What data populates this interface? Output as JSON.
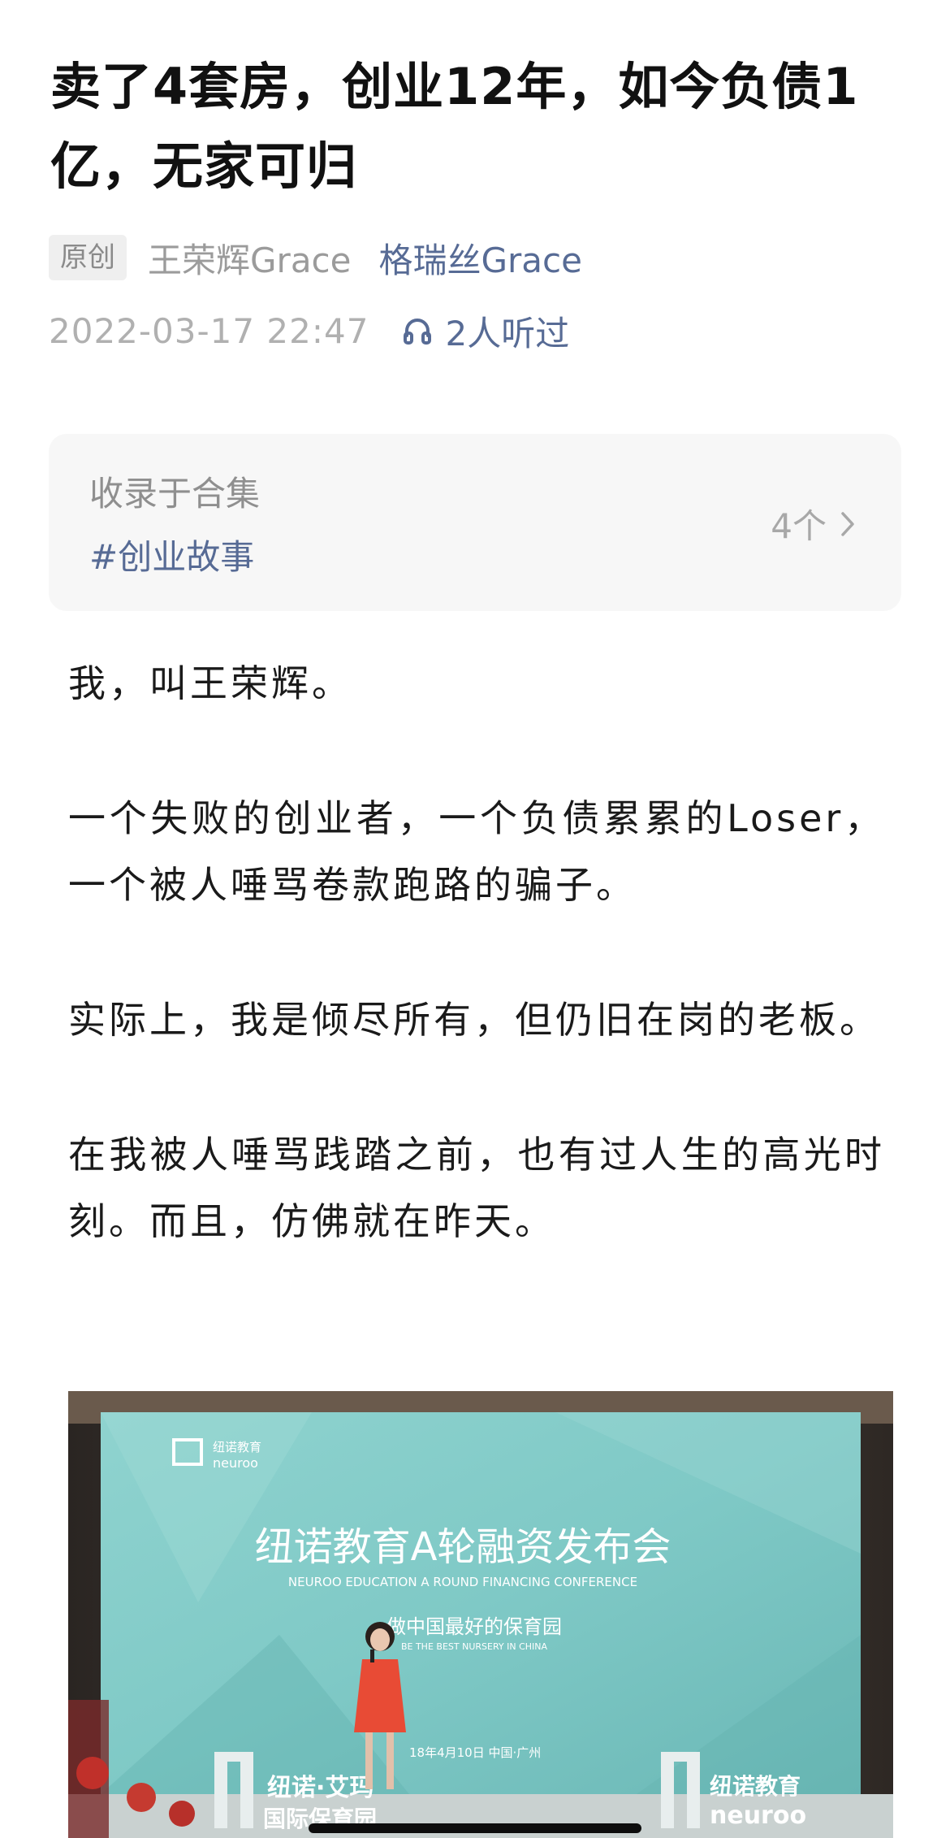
{
  "article": {
    "title": "卖了4套房，创业12年，如今负债1亿，无家可归",
    "original_badge": "原创",
    "author": "王荣辉Grace",
    "account": "格瑞丝Grace",
    "date": "2022-03-17 22:47",
    "listen_count": "2人听过"
  },
  "collection": {
    "label": "收录于合集",
    "tag": "#创业故事",
    "count": "4个"
  },
  "paragraphs": [
    "我，叫王荣辉。",
    "一个失败的创业者，一个负债累累的Loser，一个被人唾骂卷款跑路的骗子。",
    "实际上，我是倾尽所有，但仍旧在岗的老板。",
    "在我被人唾骂践踏之前，也有过人生的高光时刻。而且，仿佛就在昨天。"
  ],
  "photo": {
    "logo_cn": "纽诺教育",
    "logo_en": "neuroo",
    "headline": "纽诺教育A轮融资发布会",
    "headline_en": "NEUROO EDUCATION A ROUND FINANCING CONFERENCE",
    "slogan": "做中国最好的保育园",
    "slogan_en": "BE THE BEST NURSERY IN CHINA",
    "date_place": "18年4月10日   中国·广州",
    "bottom_left_1": "纽诺·艾玛",
    "bottom_left_2": "国际保育园",
    "bottom_right_cn": "纽诺教育",
    "bottom_right_en": "neuroo"
  },
  "icons": {
    "listen": "headphones-icon",
    "chevron": "chevron-right-icon"
  },
  "colors": {
    "link": "#576b95",
    "meta_gray": "#9b9b9b",
    "screen_teal": "#7fc9c6"
  }
}
